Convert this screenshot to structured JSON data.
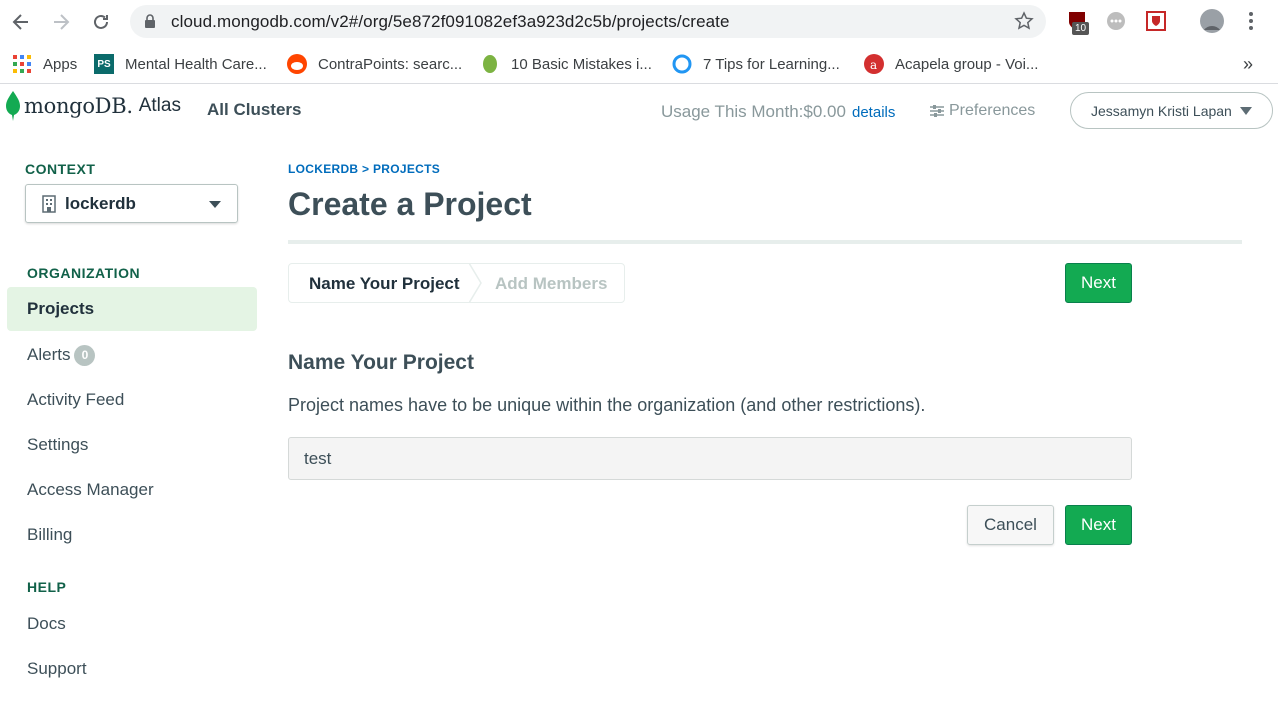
{
  "browser": {
    "url": "cloud.mongodb.com/v2#/org/5e872f091082ef3a923d2c5b/projects/create",
    "extension_badge": "10",
    "bookmarks": [
      {
        "label": "Apps"
      },
      {
        "label": "Mental Health Care..."
      },
      {
        "label": "ContraPoints: searc..."
      },
      {
        "label": "10 Basic Mistakes i..."
      },
      {
        "label": "7 Tips for Learning..."
      },
      {
        "label": "Acapela group - Voi..."
      }
    ],
    "overflow": "»"
  },
  "header": {
    "logo_text": "mongoDB.",
    "logo_atlas": "Atlas",
    "all_clusters": "All Clusters",
    "usage_label": "Usage This Month:$0.00",
    "usage_details": "details",
    "preferences": "Preferences",
    "user_name": "Jessamyn Kristi Lapan"
  },
  "sidebar": {
    "context_label": "CONTEXT",
    "context_value": "lockerdb",
    "organization_label": "ORGANIZATION",
    "org_items": [
      {
        "label": "Projects",
        "active": true
      },
      {
        "label": "Alerts",
        "badge": "0"
      },
      {
        "label": "Activity Feed"
      },
      {
        "label": "Settings"
      },
      {
        "label": "Access Manager"
      },
      {
        "label": "Billing"
      }
    ],
    "help_label": "HELP",
    "help_items": [
      {
        "label": "Docs"
      },
      {
        "label": "Support"
      }
    ]
  },
  "main": {
    "breadcrumb": "LOCKERDB > PROJECTS",
    "title": "Create a Project",
    "steps": [
      {
        "label": "Name Your Project",
        "active": true
      },
      {
        "label": "Add Members",
        "active": false
      }
    ],
    "next_label": "Next",
    "section_title": "Name Your Project",
    "section_desc": "Project names have to be unique within the organization (and other restrictions).",
    "project_name_value": "test",
    "cancel_label": "Cancel",
    "submit_label": "Next"
  },
  "colors": {
    "brand_green": "#13aa52",
    "link_blue": "#006cbc",
    "active_bg": "#e4f4e4"
  }
}
